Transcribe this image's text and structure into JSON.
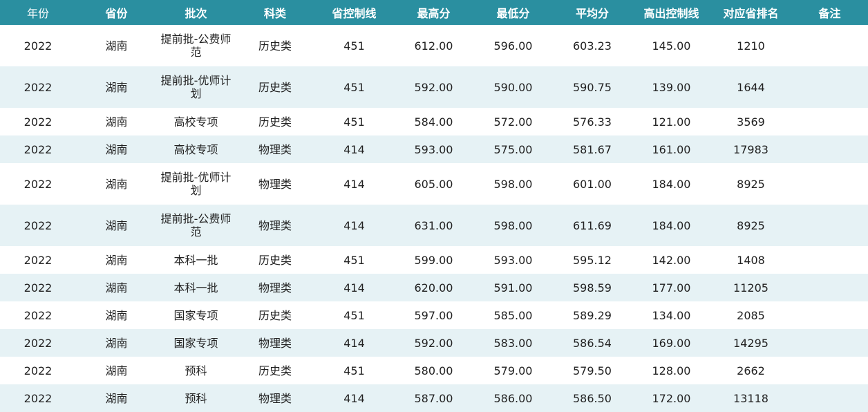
{
  "table": {
    "headers": [
      "年份",
      "省份",
      "批次",
      "科类",
      "省控制线",
      "最高分",
      "最低分",
      "平均分",
      "高出控制线",
      "对应省排名",
      "备注"
    ],
    "rows": [
      {
        "year": "2022",
        "province": "湖南",
        "batch": "提前批-公费师范",
        "category": "历史类",
        "control_line": "451",
        "max": "612.00",
        "min": "596.00",
        "avg": "603.23",
        "above_line": "145.00",
        "rank": "1210",
        "note": ""
      },
      {
        "year": "2022",
        "province": "湖南",
        "batch": "提前批-优师计划",
        "category": "历史类",
        "control_line": "451",
        "max": "592.00",
        "min": "590.00",
        "avg": "590.75",
        "above_line": "139.00",
        "rank": "1644",
        "note": ""
      },
      {
        "year": "2022",
        "province": "湖南",
        "batch": "高校专项",
        "category": "历史类",
        "control_line": "451",
        "max": "584.00",
        "min": "572.00",
        "avg": "576.33",
        "above_line": "121.00",
        "rank": "3569",
        "note": ""
      },
      {
        "year": "2022",
        "province": "湖南",
        "batch": "高校专项",
        "category": "物理类",
        "control_line": "414",
        "max": "593.00",
        "min": "575.00",
        "avg": "581.67",
        "above_line": "161.00",
        "rank": "17983",
        "note": ""
      },
      {
        "year": "2022",
        "province": "湖南",
        "batch": "提前批-优师计划",
        "category": "物理类",
        "control_line": "414",
        "max": "605.00",
        "min": "598.00",
        "avg": "601.00",
        "above_line": "184.00",
        "rank": "8925",
        "note": ""
      },
      {
        "year": "2022",
        "province": "湖南",
        "batch": "提前批-公费师范",
        "category": "物理类",
        "control_line": "414",
        "max": "631.00",
        "min": "598.00",
        "avg": "611.69",
        "above_line": "184.00",
        "rank": "8925",
        "note": ""
      },
      {
        "year": "2022",
        "province": "湖南",
        "batch": "本科一批",
        "category": "历史类",
        "control_line": "451",
        "max": "599.00",
        "min": "593.00",
        "avg": "595.12",
        "above_line": "142.00",
        "rank": "1408",
        "note": ""
      },
      {
        "year": "2022",
        "province": "湖南",
        "batch": "本科一批",
        "category": "物理类",
        "control_line": "414",
        "max": "620.00",
        "min": "591.00",
        "avg": "598.59",
        "above_line": "177.00",
        "rank": "11205",
        "note": ""
      },
      {
        "year": "2022",
        "province": "湖南",
        "batch": "国家专项",
        "category": "历史类",
        "control_line": "451",
        "max": "597.00",
        "min": "585.00",
        "avg": "589.29",
        "above_line": "134.00",
        "rank": "2085",
        "note": ""
      },
      {
        "year": "2022",
        "province": "湖南",
        "batch": "国家专项",
        "category": "物理类",
        "control_line": "414",
        "max": "592.00",
        "min": "583.00",
        "avg": "586.54",
        "above_line": "169.00",
        "rank": "14295",
        "note": ""
      },
      {
        "year": "2022",
        "province": "湖南",
        "batch": "预科",
        "category": "历史类",
        "control_line": "451",
        "max": "580.00",
        "min": "579.00",
        "avg": "579.50",
        "above_line": "128.00",
        "rank": "2662",
        "note": ""
      },
      {
        "year": "2022",
        "province": "湖南",
        "batch": "预科",
        "category": "物理类",
        "control_line": "414",
        "max": "587.00",
        "min": "586.00",
        "avg": "586.50",
        "above_line": "172.00",
        "rank": "13118",
        "note": ""
      }
    ]
  }
}
